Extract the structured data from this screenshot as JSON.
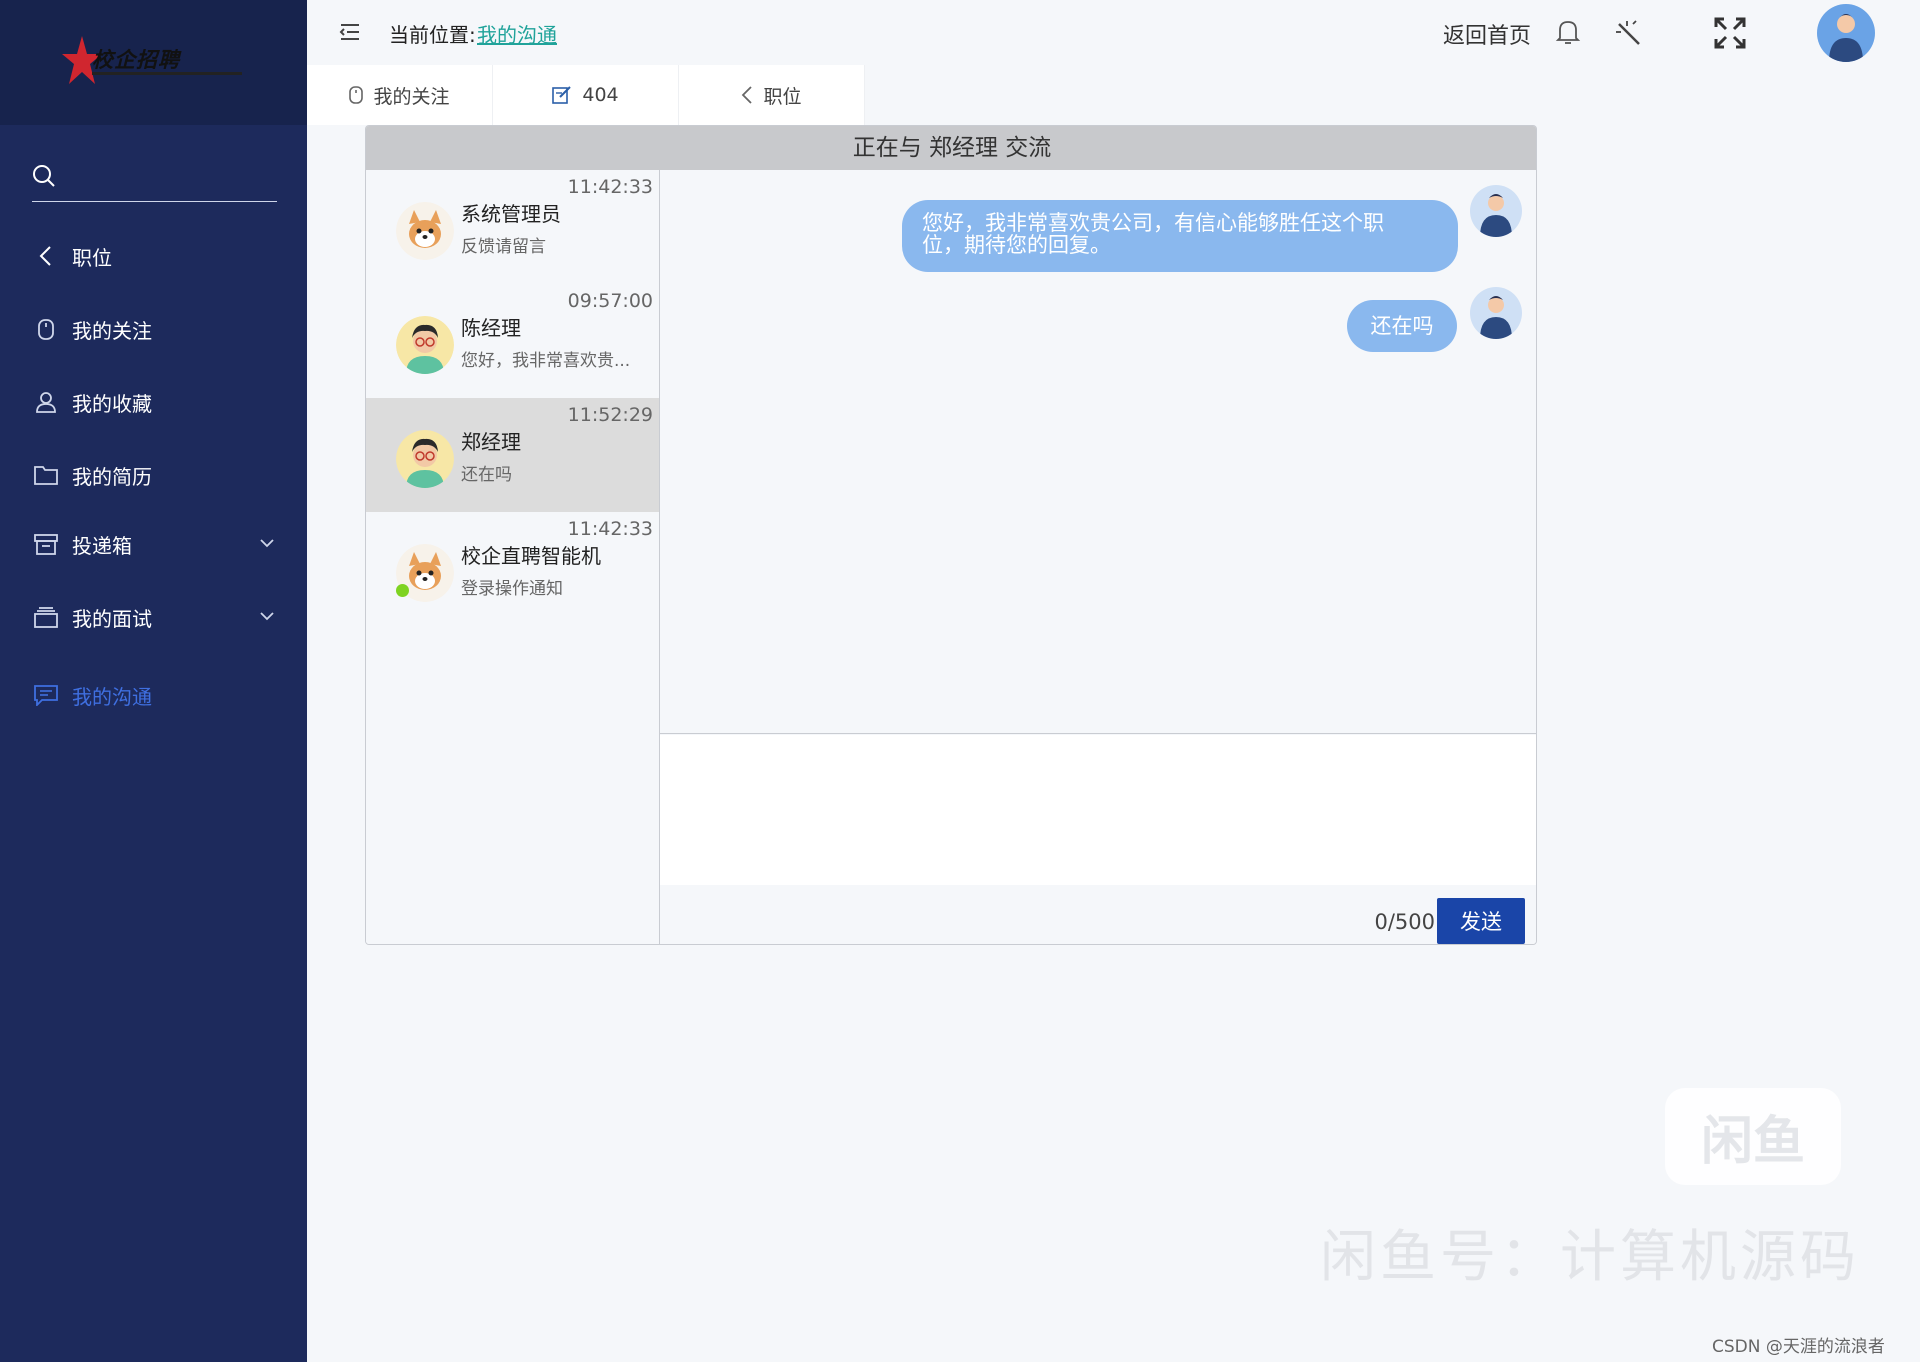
{
  "logo": {
    "text": "校企招聘"
  },
  "sidebar": {
    "search_placeholder": "",
    "items": [
      {
        "label": "职位",
        "icon": "chevron-left-icon"
      },
      {
        "label": "我的关注",
        "icon": "mouse-icon"
      },
      {
        "label": "我的收藏",
        "icon": "user-icon"
      },
      {
        "label": "我的简历",
        "icon": "folder-icon"
      },
      {
        "label": "投递箱",
        "icon": "box-icon",
        "has_submenu": true
      },
      {
        "label": "我的面试",
        "icon": "layers-icon",
        "has_submenu": true
      },
      {
        "label": "我的沟通",
        "icon": "message-icon",
        "active": true
      }
    ]
  },
  "header": {
    "breadcrumb_label": "当前位置:",
    "breadcrumb_current": "我的沟通",
    "home_link": "返回首页"
  },
  "tabs": [
    {
      "label": "我的关注",
      "icon": "mouse-icon"
    },
    {
      "label": "404",
      "icon": "edit-icon"
    },
    {
      "label": "职位",
      "icon": "chevron-left-icon"
    }
  ],
  "chat": {
    "title": "正在与 郑经理 交流",
    "contacts": [
      {
        "name": "系统管理员",
        "time": "11:42:33",
        "preview": "反馈请留言",
        "avatar": "cartoon-dog"
      },
      {
        "name": "陈经理",
        "time": "09:57:00",
        "preview": "您好，我非常喜欢贵...",
        "avatar": "man-glasses"
      },
      {
        "name": "郑经理",
        "time": "11:52:29",
        "preview": "还在吗",
        "avatar": "man-glasses",
        "active": true
      },
      {
        "name": "校企直聘智能机",
        "time": "11:42:33",
        "preview": "登录操作通知",
        "avatar": "cartoon-dog",
        "online": true
      }
    ],
    "messages": [
      {
        "line1": "您好，我非常喜欢贵公司，有信心能够胜任这个职",
        "line2": "位，期待您的回复。"
      },
      {
        "line1": "还在吗"
      }
    ],
    "input_value": "",
    "counter": "0/500",
    "send_label": "发送"
  },
  "watermark": {
    "badge": "闲鱼",
    "text": "闲鱼号：计算机源码",
    "credit": "CSDN @天涯的流浪者"
  },
  "colors": {
    "sidebar_bg": "#1d2a5c",
    "accent_link": "#20a39a",
    "active_nav": "#3f6fe0",
    "bubble": "#8ab8ee",
    "send_button": "#1a45a8"
  }
}
